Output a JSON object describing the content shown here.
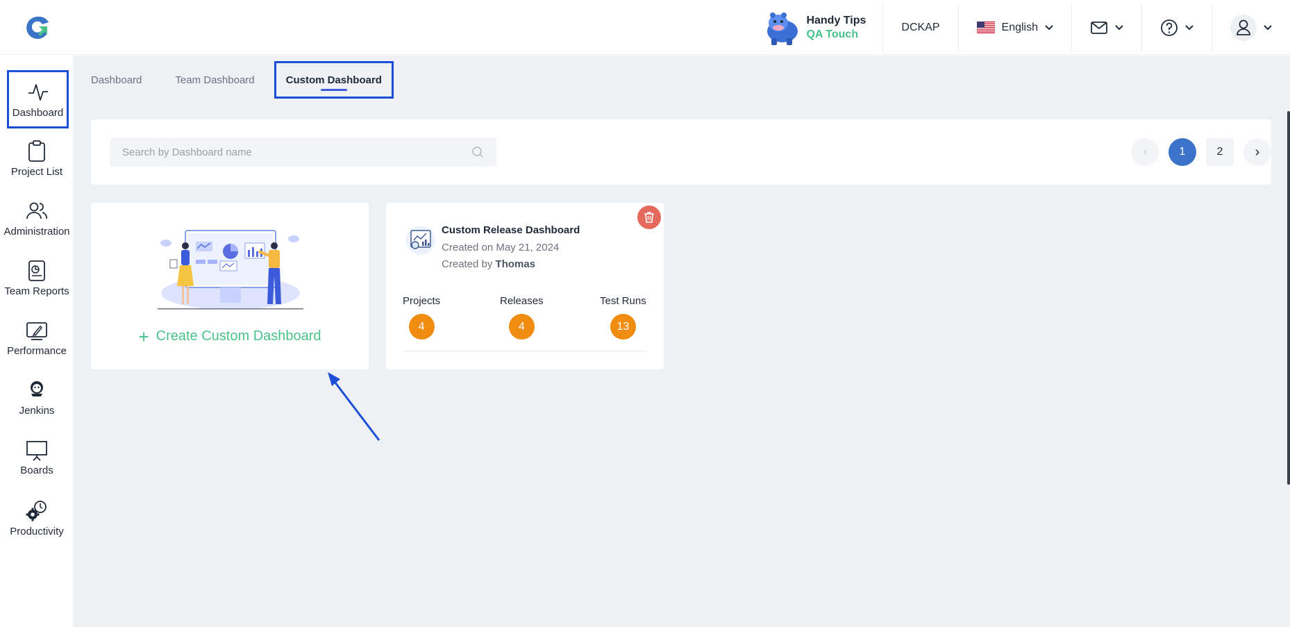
{
  "header": {
    "tips_title": "Handy Tips",
    "tips_subtitle": "QA Touch",
    "org": "DCKAP",
    "language": "English",
    "icons": [
      "mail-icon",
      "help-icon",
      "user-icon"
    ]
  },
  "sidebar": {
    "items": [
      {
        "label": "Dashboard",
        "icon": "activity-icon"
      },
      {
        "label": "Project List",
        "icon": "clipboard-icon"
      },
      {
        "label": "Administration",
        "icon": "users-icon"
      },
      {
        "label": "Team Reports",
        "icon": "report-icon"
      },
      {
        "label": "Performance",
        "icon": "rocket-icon"
      },
      {
        "label": "Jenkins",
        "icon": "jenkins-icon"
      },
      {
        "label": "Boards",
        "icon": "board-icon"
      },
      {
        "label": "Productivity",
        "icon": "gear-clock-icon"
      }
    ]
  },
  "tabs": [
    {
      "label": "Dashboard"
    },
    {
      "label": "Team Dashboard"
    },
    {
      "label": "Custom Dashboard"
    }
  ],
  "search": {
    "placeholder": "Search by Dashboard name",
    "value": ""
  },
  "pagination": {
    "prev": "‹",
    "pages": [
      "1",
      "2"
    ],
    "current": "1",
    "next": "›"
  },
  "create_card": {
    "label": "Create Custom Dashboard"
  },
  "dashboard_card": {
    "title": "Custom Release Dashboard",
    "created_on": "Created on May 21, 2024",
    "created_by_prefix": "Created by",
    "created_by": "Thomas",
    "stats": [
      {
        "label": "Projects",
        "value": "4"
      },
      {
        "label": "Releases",
        "value": "4"
      },
      {
        "label": "Test Runs",
        "value": "13"
      }
    ]
  },
  "colors": {
    "accent_blue": "#1d4ed8",
    "green": "#49c28a",
    "badge_orange": "#f08c0f",
    "delete_red": "#e5695d",
    "page_active": "#3a73c8"
  }
}
